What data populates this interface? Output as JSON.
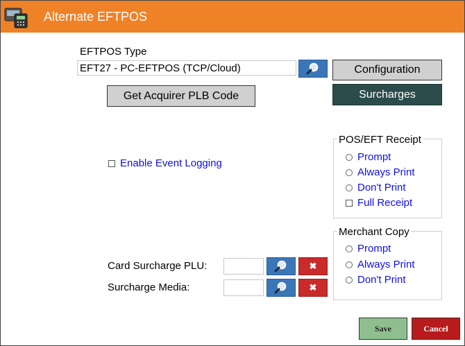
{
  "window": {
    "title": "Alternate EFTPOS"
  },
  "colors": {
    "titlebar": "#ef8227",
    "link_text": "#1010e0",
    "search_button": "#3a76b8",
    "clear_button": "#c92a2a",
    "surcharges_button": "#2c4b4b",
    "save_button": "#8fbf8f",
    "cancel_button": "#b81b1b"
  },
  "icons": {
    "app": "eftpos-terminal-icon",
    "search": "magnifier-icon",
    "clear": "x-icon"
  },
  "eftpos": {
    "type_label": "EFTPOS Type",
    "type_value": "EFT27 - PC-EFTPOS (TCP/Cloud)"
  },
  "buttons": {
    "configuration": "Configuration",
    "get_acquirer": "Get Acquirer PLB Code",
    "surcharges": "Surcharges",
    "save": "Save",
    "cancel": "Cancel",
    "clear_glyph": "✖"
  },
  "event_logging": {
    "label": "Enable Event Logging",
    "checked": false
  },
  "pos_receipt": {
    "title": "POS/EFT Receipt",
    "options": [
      "Prompt",
      "Always Print",
      "Don't Print"
    ],
    "full_receipt": "Full Receipt"
  },
  "merchant_copy": {
    "title": "Merchant Copy",
    "options": [
      "Prompt",
      "Always Print",
      "Don't Print"
    ]
  },
  "surcharge": {
    "plu_label": "Card Surcharge PLU:",
    "plu_value": "",
    "media_label": "Surcharge Media:",
    "media_value": ""
  }
}
